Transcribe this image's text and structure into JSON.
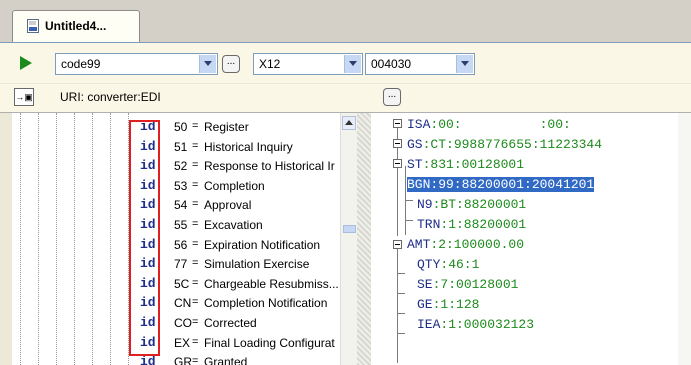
{
  "tab": {
    "title": "Untitled4..."
  },
  "toolbar": {
    "code_combo": "code99",
    "format_combo": "X12",
    "version_combo": "004030",
    "ellipsis": "...",
    "uri_label": "URI: converter:EDI",
    "uri_button_icon": "→▣"
  },
  "left_rows": [
    {
      "kw": "id",
      "val": "50",
      "eq": "=",
      "desc": "Register"
    },
    {
      "kw": "id",
      "val": "51",
      "eq": "=",
      "desc": "Historical Inquiry"
    },
    {
      "kw": "id",
      "val": "52",
      "eq": "=",
      "desc": "Response to Historical Ir"
    },
    {
      "kw": "id",
      "val": "53",
      "eq": "=",
      "desc": "Completion"
    },
    {
      "kw": "id",
      "val": "54",
      "eq": "=",
      "desc": "Approval"
    },
    {
      "kw": "id",
      "val": "55",
      "eq": "=",
      "desc": "Excavation"
    },
    {
      "kw": "id",
      "val": "56",
      "eq": "=",
      "desc": "Expiration Notification"
    },
    {
      "kw": "id",
      "val": "77",
      "eq": "=",
      "desc": "Simulation Exercise"
    },
    {
      "kw": "id",
      "val": "5C",
      "eq": "=",
      "desc": "Chargeable Resubmiss..."
    },
    {
      "kw": "id",
      "val": "CN",
      "eq": "=",
      "desc": "Completion Notification"
    },
    {
      "kw": "id",
      "val": "CO",
      "eq": "=",
      "desc": "Corrected"
    },
    {
      "kw": "id",
      "val": "EX",
      "eq": "=",
      "desc": "Final Loading Configurat"
    },
    {
      "kw": "id",
      "val": "GR",
      "eq": "=",
      "desc": "Granted"
    }
  ],
  "edi_lines": [
    {
      "seg": "ISA",
      "rest": ":00:          :00:"
    },
    {
      "seg": "GS",
      "rest": ":CT:9988776655:11223344"
    },
    {
      "seg": "ST",
      "rest": ":831:00128001"
    },
    {
      "seg": "BGN",
      "rest": ":99:88200001:20041201"
    },
    {
      "seg": "N9",
      "rest": ":BT:88200001"
    },
    {
      "seg": "TRN",
      "rest": ":1:88200001"
    },
    {
      "seg": "AMT",
      "rest": ":2:100000.00"
    },
    {
      "seg": "QTY",
      "rest": ":46:1"
    },
    {
      "seg": "SE",
      "rest": ":7:00128001"
    },
    {
      "seg": "GE",
      "rest": ":1:128"
    },
    {
      "seg": "IEA",
      "rest": ":1:000032123"
    }
  ],
  "colors": {
    "selection": "#316ac5",
    "keyword": "#1e2e8a",
    "value_green": "#1c8a1c",
    "highlight_box": "#e02020",
    "run": "#1d8a1d"
  }
}
